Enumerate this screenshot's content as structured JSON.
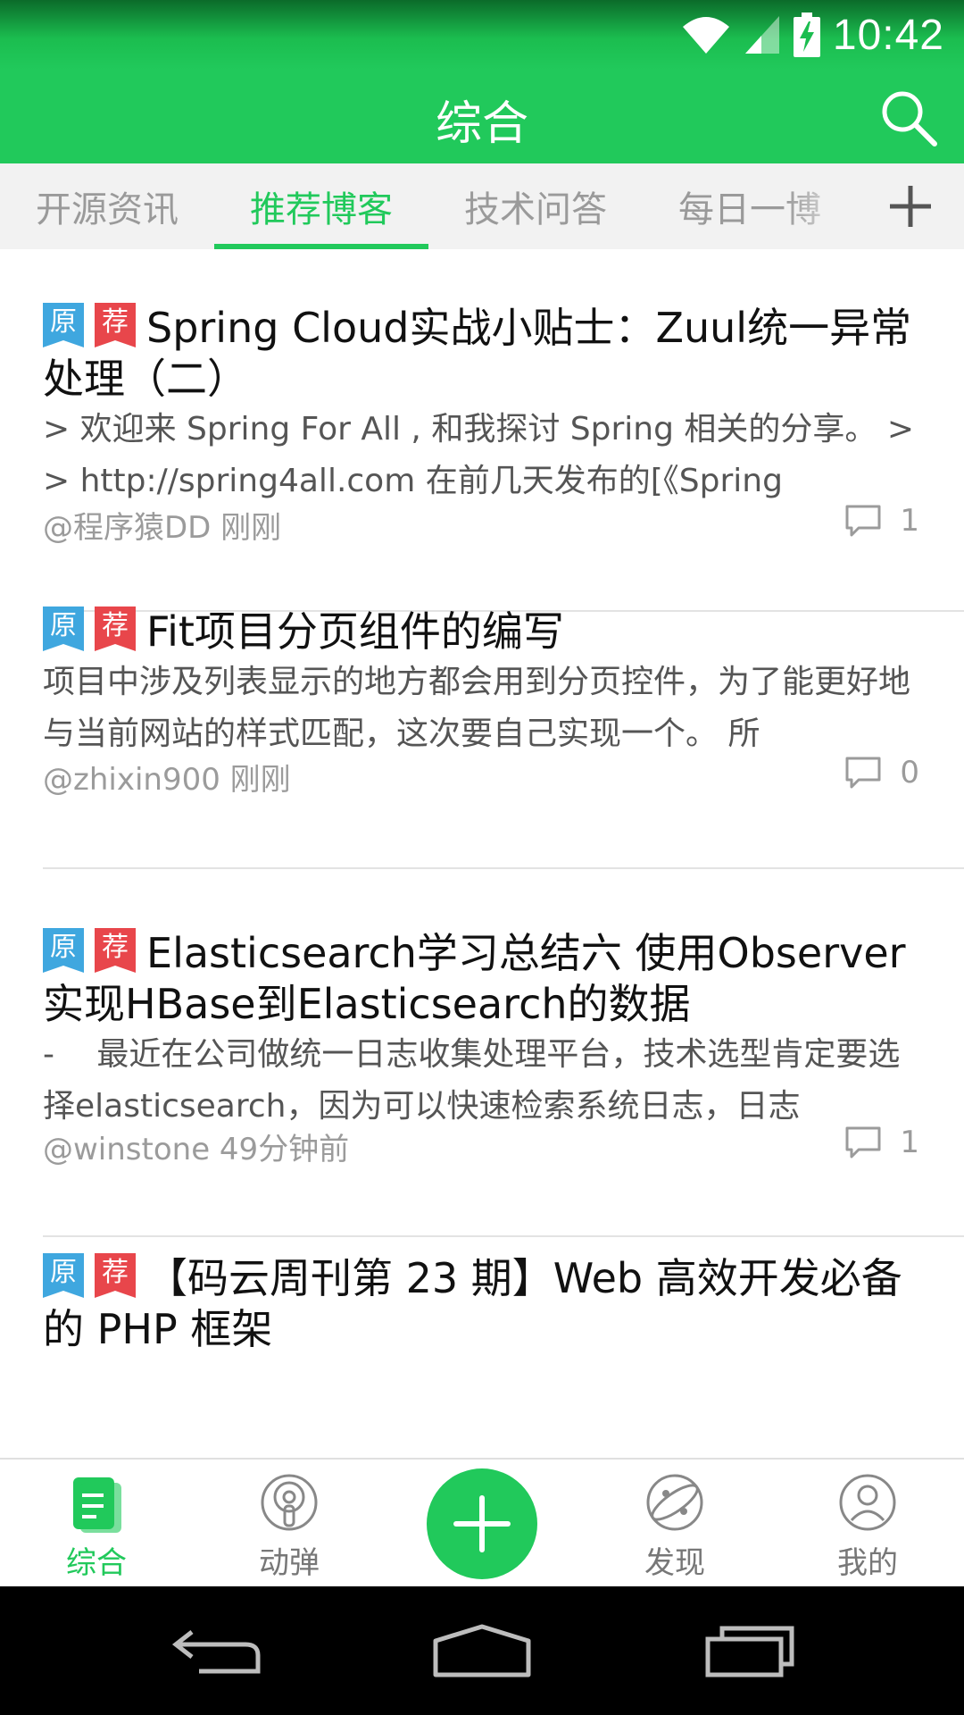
{
  "status_bar": {
    "time": "10:42"
  },
  "app_bar": {
    "title": "综合"
  },
  "tabs": [
    {
      "label": "开源资讯",
      "active": false
    },
    {
      "label": "推荐博客",
      "active": true
    },
    {
      "label": "技术问答",
      "active": false
    },
    {
      "label": "每日一博",
      "active": false
    }
  ],
  "badges": {
    "original": "原",
    "recommended": "荐"
  },
  "posts": [
    {
      "title": "Spring Cloud实战小贴士：Zuul统一异常处理（二）",
      "summary": "> 欢迎来 Spring For All , 和我探讨 Spring 相关的分享。 > > http://spring4all.com 在前几天发布的[《Spring",
      "meta": "@程序猿DD 刚刚",
      "comments": "1"
    },
    {
      "title": "Fit项目分页组件的编写",
      "summary": "项目中涉及列表显示的地方都会用到分页控件，为了能更好地与当前网站的样式匹配，这次要自己实现一个。 所",
      "meta": "@zhixin900 刚刚",
      "comments": "0"
    },
    {
      "title": "Elasticsearch学习总结六 使用Observer实现HBase到Elasticsearch的数据",
      "summary": "-　 最近在公司做统一日志收集处理平台，技术选型肯定要选择elasticsearch，因为可以快速检索系统日志，日志",
      "meta": "@winstone 49分钟前",
      "comments": "1"
    },
    {
      "title": "【码云周刊第 23 期】Web 高效开发必备的 PHP 框架"
    }
  ],
  "bottom_nav": [
    {
      "label": "综合",
      "icon": "doc-icon",
      "active": true
    },
    {
      "label": "动弹",
      "icon": "tweet-icon",
      "active": false
    },
    {
      "label": "发现",
      "icon": "planet-icon",
      "active": false
    },
    {
      "label": "我的",
      "icon": "user-icon",
      "active": false
    }
  ],
  "colors": {
    "accent": "#21c95b",
    "badge_original": "#3fa7df",
    "badge_recommended": "#e8464b"
  }
}
